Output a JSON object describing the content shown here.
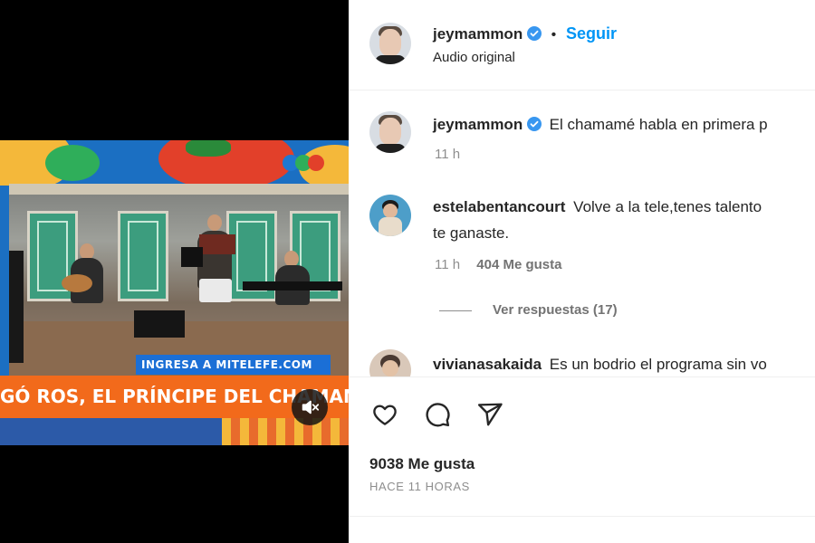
{
  "video": {
    "web_strip": "INGRESA A MITELEFE.COM",
    "ticker": "GÓ ROS, EL PRÍNCIPE DEL CHAMAMÉ",
    "mute_icon": "muted-speaker-icon"
  },
  "header": {
    "username": "jeymammon",
    "separator": "•",
    "follow_label": "Seguir",
    "audio_label": "Audio original"
  },
  "caption": {
    "username": "jeymammon",
    "text": "El chamamé habla en primera p",
    "time": "11 h"
  },
  "comments": [
    {
      "username": "estelabentancourt",
      "text_line1": "Volve a la tele,tenes talento",
      "text_line2": "te ganaste.",
      "time": "11 h",
      "likes": "404 Me gusta"
    },
    {
      "username": "vivianasakaida",
      "text_line1": "Es un bodrio el programa sin vo"
    }
  ],
  "replies": {
    "label": "Ver respuestas (17)"
  },
  "actions": {
    "like_icon": "heart-icon",
    "comment_icon": "comment-bubble-icon",
    "share_icon": "paper-plane-icon"
  },
  "stats": {
    "likes": "9038 Me gusta",
    "posted": "HACE 11 HORAS"
  },
  "colors": {
    "accent": "#0095f6",
    "verified": "#3897f0",
    "ticker": "#f26a1b"
  }
}
